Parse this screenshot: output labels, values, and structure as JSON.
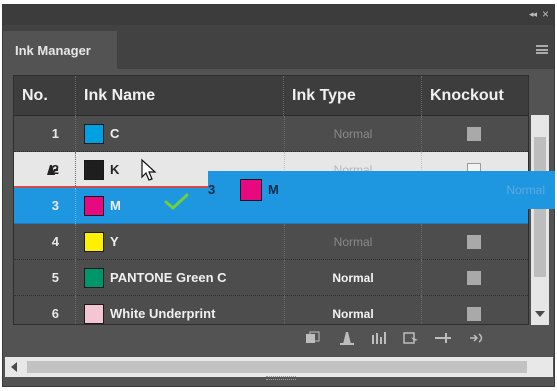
{
  "panel": {
    "tab_title": "Ink Manager",
    "collapse_glyph": "◂◂",
    "close_glyph": "×"
  },
  "table": {
    "headers": [
      "No.",
      "Ink Name",
      "Ink Type",
      "Knockout"
    ],
    "rows": [
      {
        "no": "1",
        "name": "C",
        "color": "#00a0e3",
        "type": "Normal",
        "type_style": "dim",
        "knockout": "on"
      },
      {
        "no": "2",
        "name": "K",
        "color": "#1e1e1e",
        "type": "Normal",
        "type_style": "dim",
        "knockout": "off"
      },
      {
        "no": "3",
        "name": "M",
        "color": "#e6097f",
        "type": "",
        "type_style": "dim",
        "knockout": ""
      },
      {
        "no": "4",
        "name": "Y",
        "color": "#fff000",
        "type": "Normal",
        "type_style": "dim",
        "knockout": "on"
      },
      {
        "no": "5",
        "name": "PANTONE Green C",
        "color": "#00966b",
        "type": "Normal",
        "type_style": "bright",
        "knockout": "on"
      },
      {
        "no": "6",
        "name": "White Underprint",
        "color": "#f4c6d4",
        "type": "Normal",
        "type_style": "bright",
        "knockout": "on"
      }
    ]
  },
  "drag_ghost": {
    "no": "3",
    "name": "M",
    "color": "#e6097f",
    "type": "Normal"
  },
  "toolbar_icons": [
    "ink-alias-icon",
    "pen-icon",
    "ink-order-icon",
    "preview-icon",
    "separator-icon",
    "swap-icon"
  ],
  "colors": {
    "panel_bg": "#535353",
    "selection": "#1f96e0",
    "drop_indicator": "#d24a4a"
  }
}
